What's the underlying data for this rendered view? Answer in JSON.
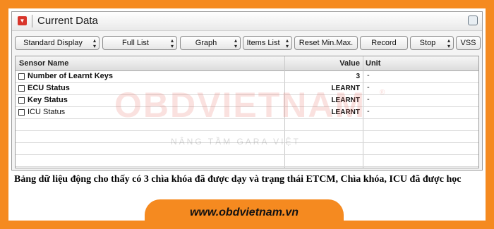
{
  "window": {
    "title": "Current Data"
  },
  "toolbar": {
    "buttons": [
      {
        "label": "Standard Display",
        "arrow": true
      },
      {
        "label": "Full List",
        "arrow": true
      },
      {
        "label": "Graph",
        "arrow": true
      },
      {
        "label": "Items List",
        "arrow": true
      },
      {
        "label": "Reset Min.Max.",
        "arrow": false
      },
      {
        "label": "Record",
        "arrow": false
      },
      {
        "label": "Stop",
        "arrow": true
      },
      {
        "label": "VSS",
        "arrow": false
      }
    ]
  },
  "table": {
    "columns": {
      "name": "Sensor Name",
      "value": "Value",
      "unit": "Unit"
    },
    "rows": [
      {
        "name": "Number of Learnt Keys",
        "value": "3",
        "unit": "-"
      },
      {
        "name": "ECU Status",
        "value": "LEARNT",
        "unit": "-"
      },
      {
        "name": "Key Status",
        "value": "LEARNT",
        "unit": "-"
      },
      {
        "name": "ICU Status",
        "value": "LEARNT",
        "unit": "-"
      }
    ]
  },
  "watermark": {
    "logo": "OBDVIETNAM",
    "registered": "®",
    "slogan": "NÂNG TẦM GARA VIỆT"
  },
  "caption": "Bảng dữ liệu động cho thấy có 3 chìa khóa đã được dạy và trạng thái ETCM, Chìa khóa, ICU đã được học",
  "footer": {
    "url": "www.obdvietnam.vn"
  },
  "colors": {
    "frame": "#f58a20",
    "window_bg": "#f4f4f4",
    "app_icon": "#d8352b"
  }
}
